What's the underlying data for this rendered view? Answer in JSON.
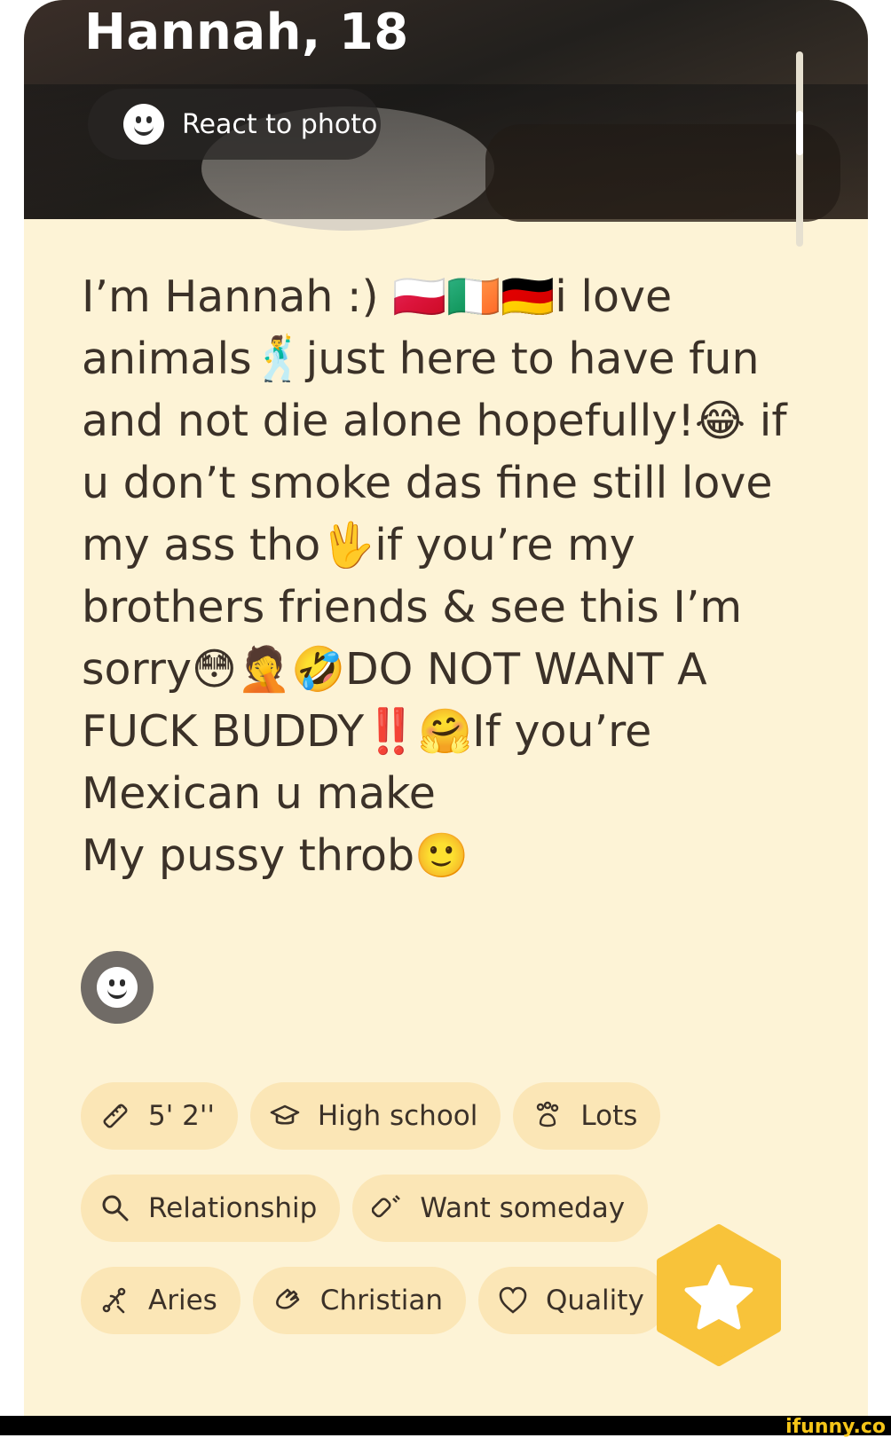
{
  "profile": {
    "name_age": "Hannah, 18",
    "react_label": "React to photo",
    "bio": "I’m Hannah :) 🇵🇱🇮🇪🇩🇪i love animals🕺just here to have fun and not die alone hopefully!😂 if u don’t smoke das fine still love my ass tho🖖if you’re my brothers friends & see this I’m sorry😳🤦🤣DO NOT WANT A FUCK BUDDY‼️🤗If you’re Mexican u make\nMy pussy throb🙂"
  },
  "chips": {
    "height": {
      "label": "5' 2''",
      "icon": "ruler-icon"
    },
    "education": {
      "label": "High school",
      "icon": "graduation-cap-icon"
    },
    "pets": {
      "label": "Lots",
      "icon": "paw-icon"
    },
    "looking_for": {
      "label": "Relationship",
      "icon": "search-icon"
    },
    "kids": {
      "label": "Want someday",
      "icon": "baby-bottle-icon"
    },
    "zodiac": {
      "label": "Aries",
      "icon": "zodiac-icon"
    },
    "religion": {
      "label": "Christian",
      "icon": "praying-hands-icon"
    },
    "love_language": {
      "label": "Quality",
      "icon": "heart-icon"
    }
  },
  "colors": {
    "card_background": "#fdf3d6",
    "chip_background": "#fbe6b6",
    "superswipe": "#f8c33a",
    "text": "#3b3128"
  },
  "watermark": "ifunny.co"
}
